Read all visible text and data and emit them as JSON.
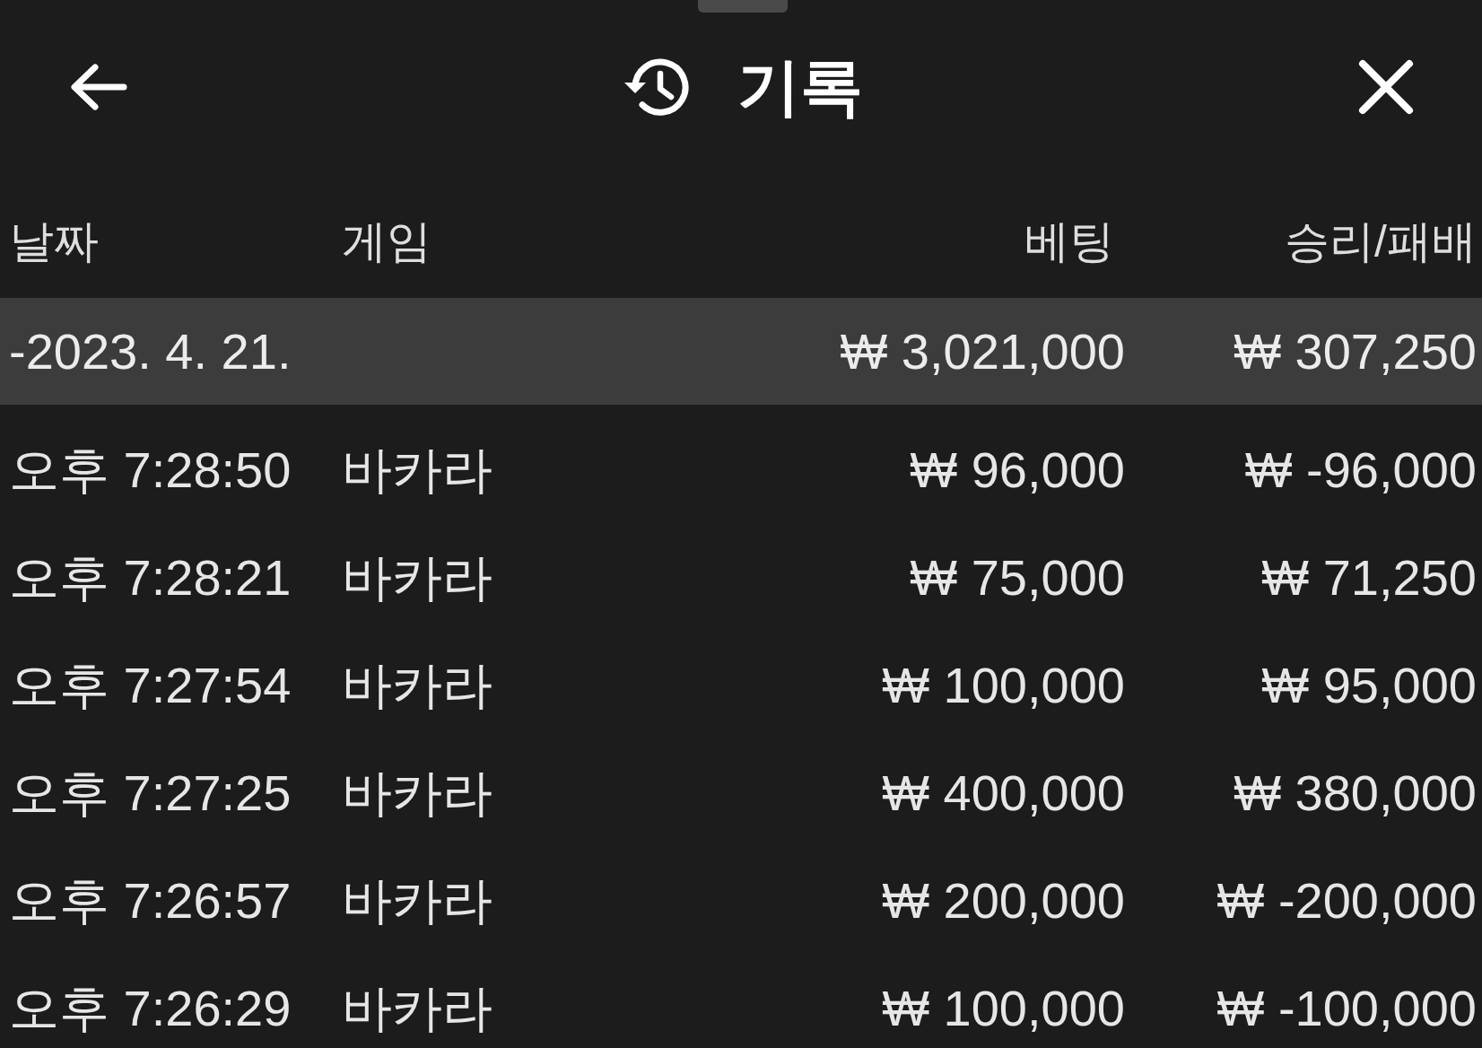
{
  "header": {
    "title": "기록"
  },
  "table": {
    "columns": [
      "날짜",
      "게임",
      "베팅",
      "승리/패배"
    ],
    "groups": [
      {
        "date": "-2023. 4. 21.",
        "bet_total": "₩ 3,021,000",
        "win_loss_total": "₩ 307,250",
        "rows": [
          {
            "time": "오후 7:28:50",
            "game": "바카라",
            "bet": "₩ 96,000",
            "win_loss": "₩ -96,000"
          },
          {
            "time": "오후 7:28:21",
            "game": "바카라",
            "bet": "₩ 75,000",
            "win_loss": "₩ 71,250"
          },
          {
            "time": "오후 7:27:54",
            "game": "바카라",
            "bet": "₩ 100,000",
            "win_loss": "₩ 95,000"
          },
          {
            "time": "오후 7:27:25",
            "game": "바카라",
            "bet": "₩ 400,000",
            "win_loss": "₩ 380,000"
          },
          {
            "time": "오후 7:26:57",
            "game": "바카라",
            "bet": "₩ 200,000",
            "win_loss": "₩ -200,000"
          },
          {
            "time": "오후 7:26:29",
            "game": "바카라",
            "bet": "₩ 100,000",
            "win_loss": "₩ -100,000"
          }
        ]
      }
    ]
  }
}
